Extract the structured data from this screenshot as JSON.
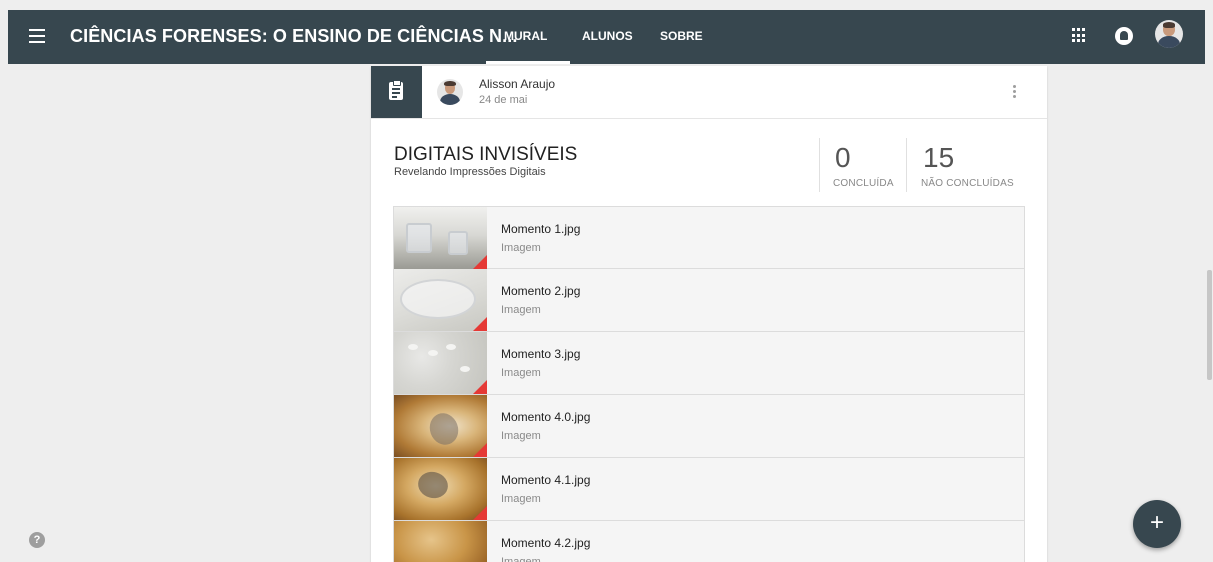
{
  "header": {
    "course_title": "CIÊNCIAS FORENSES: O ENSINO DE CIÊNCIAS N...",
    "tabs": [
      {
        "label": "MURAL",
        "active": true
      },
      {
        "label": "ALUNOS",
        "active": false
      },
      {
        "label": "SOBRE",
        "active": false
      }
    ],
    "icons": [
      "menu-icon",
      "apps-icon",
      "notifications-icon",
      "user-avatar"
    ]
  },
  "post": {
    "author": "Alisson Araujo",
    "date": "24 de mai",
    "title": "DIGITAIS INVISÍVEIS",
    "subtitle": "Revelando Impressões Digitais",
    "stats": [
      {
        "value": "0",
        "label": "CONCLUÍDA"
      },
      {
        "value": "15",
        "label": "NÃO CONCLUÍDAS"
      }
    ],
    "attachments": [
      {
        "name": "Momento 1.jpg",
        "type": "Imagem"
      },
      {
        "name": "Momento 2.jpg",
        "type": "Imagem"
      },
      {
        "name": "Momento 3.jpg",
        "type": "Imagem"
      },
      {
        "name": "Momento 4.0.jpg",
        "type": "Imagem"
      },
      {
        "name": "Momento 4.1.jpg",
        "type": "Imagem"
      },
      {
        "name": "Momento 4.2.jpg",
        "type": "Imagem"
      }
    ]
  },
  "fab": {
    "label": "+"
  },
  "help": {
    "label": "?"
  },
  "colors": {
    "header_bg": "#37474f",
    "page_bg": "#eeeeee",
    "accent_corner": "#e53935"
  }
}
